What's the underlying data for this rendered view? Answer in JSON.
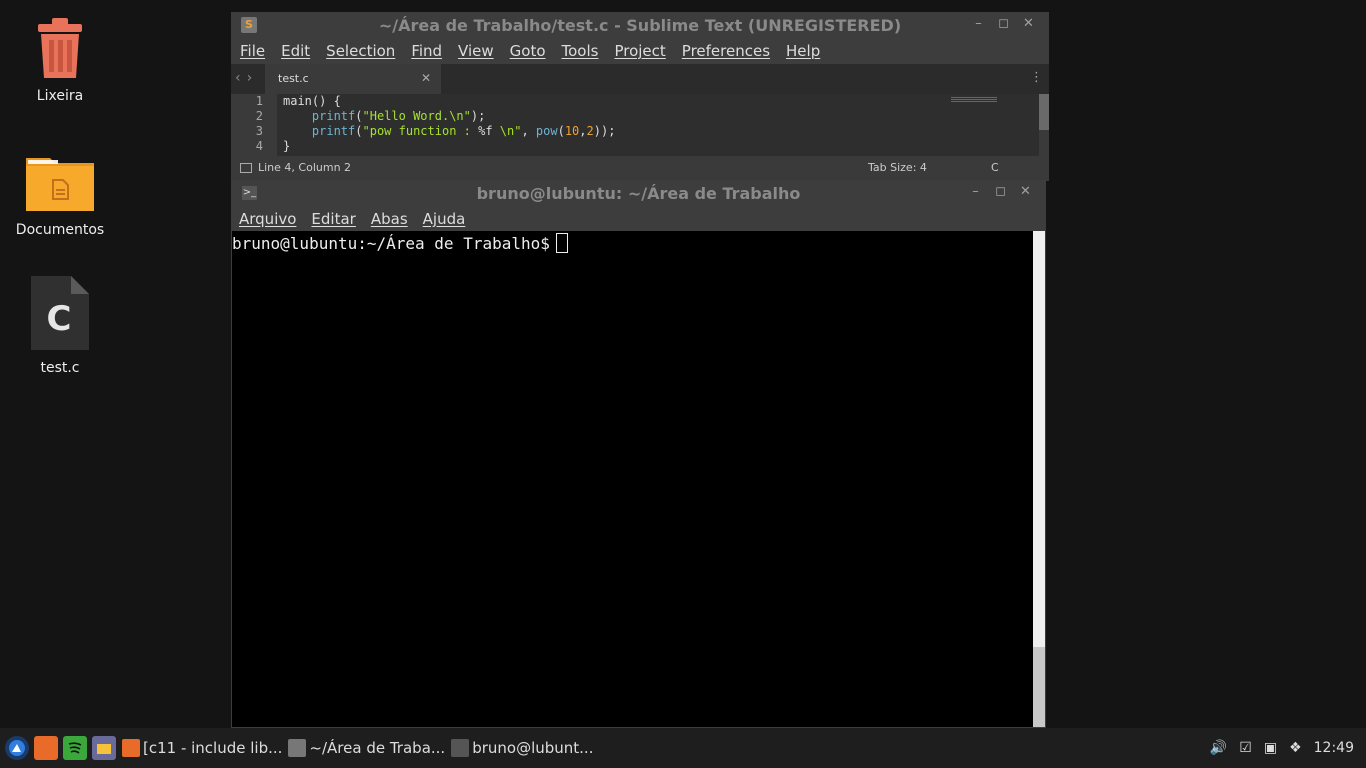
{
  "desktop": {
    "icons": [
      {
        "label": "Lixeira",
        "icon": "trash-icon"
      },
      {
        "label": "Documentos",
        "icon": "folder-icon"
      },
      {
        "label": "test.c",
        "icon": "c-file-icon"
      }
    ]
  },
  "sublime": {
    "title": "~/Área de Trabalho/test.c - Sublime Text (UNREGISTERED)",
    "menu": [
      "File",
      "Edit",
      "Selection",
      "Find",
      "View",
      "Goto",
      "Tools",
      "Project",
      "Preferences",
      "Help"
    ],
    "tab_name": "test.c",
    "line_numbers": [
      "1",
      "2",
      "3",
      "4"
    ],
    "code": {
      "l1": "main() {",
      "l2_fn": "printf",
      "l2_open": "(",
      "l2_str": "\"Hello Word.\\n\"",
      "l2_close": ");",
      "l3_fn": "printf",
      "l3_open": "(",
      "l3_str": "\"pow function : ",
      "l3_fmt": "%f",
      "l3_str2": " \\n\"",
      "l3_comma": ", ",
      "l3_fn2": "pow",
      "l3_open2": "(",
      "l3_n1": "10",
      "l3_c": ",",
      "l3_n2": "2",
      "l3_close": "));",
      "l4": "}"
    },
    "status": {
      "position": "Line 4, Column 2",
      "tab_size": "Tab Size: 4",
      "syntax": "C"
    }
  },
  "terminal": {
    "title": "bruno@lubuntu: ~/Área de Trabalho",
    "menu": [
      "Arquivo",
      "Editar",
      "Abas",
      "Ajuda"
    ],
    "prompt": "bruno@lubuntu:~/Área de Trabalho$"
  },
  "taskbar": {
    "tasks": [
      {
        "label": "[c11 - include lib...",
        "icon": "firefox-icon"
      },
      {
        "label": "~/Área de Traba...",
        "icon": "sublime-icon"
      },
      {
        "label": "bruno@lubunt...",
        "icon": "terminal-icon"
      }
    ],
    "clock": "12:49"
  }
}
